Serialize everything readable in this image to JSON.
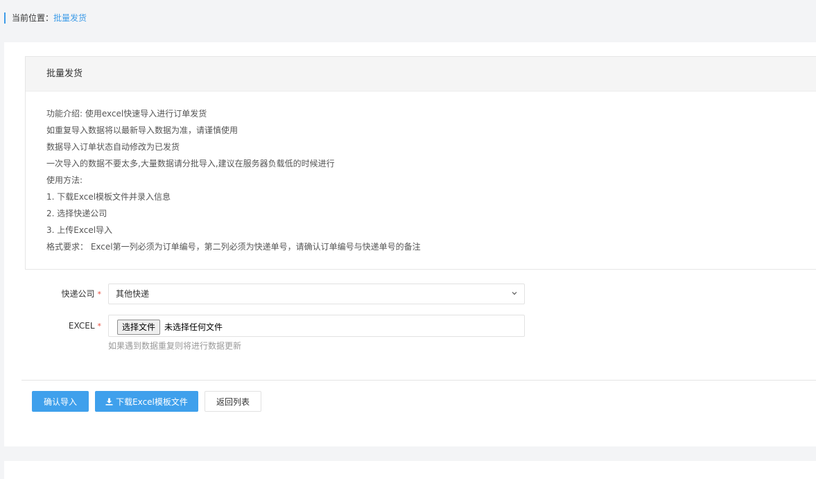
{
  "breadcrumb": {
    "prefix": "当前位置：",
    "current": "批量发货"
  },
  "panel": {
    "title": "批量发货",
    "lines": [
      "功能介绍: 使用excel快速导入进行订单发货",
      "如重复导入数据将以最新导入数据为准，请谨慎使用",
      "数据导入订单状态自动修改为已发货",
      "一次导入的数据不要太多,大量数据请分批导入,建议在服务器负载低的时候进行",
      "使用方法:",
      "1. 下载Excel模板文件并录入信息",
      "2. 选择快递公司",
      "3. 上传Excel导入",
      "格式要求： Excel第一列必须为订单编号，第二列必须为快递单号，请确认订单编号与快递单号的备注"
    ]
  },
  "form": {
    "express": {
      "label": "快递公司",
      "required_mark": "*",
      "selected": "其他快递"
    },
    "excel": {
      "label": "EXCEL",
      "required_mark": "*",
      "choose_label": "选择文件",
      "status": "未选择任何文件",
      "help": "如果遇到数据重复则将进行数据更新"
    }
  },
  "actions": {
    "confirm": "确认导入",
    "download": "下载Excel模板文件",
    "back": "返回列表"
  },
  "colors": {
    "accent": "#3fa0ec",
    "required": "#e84c3d"
  }
}
